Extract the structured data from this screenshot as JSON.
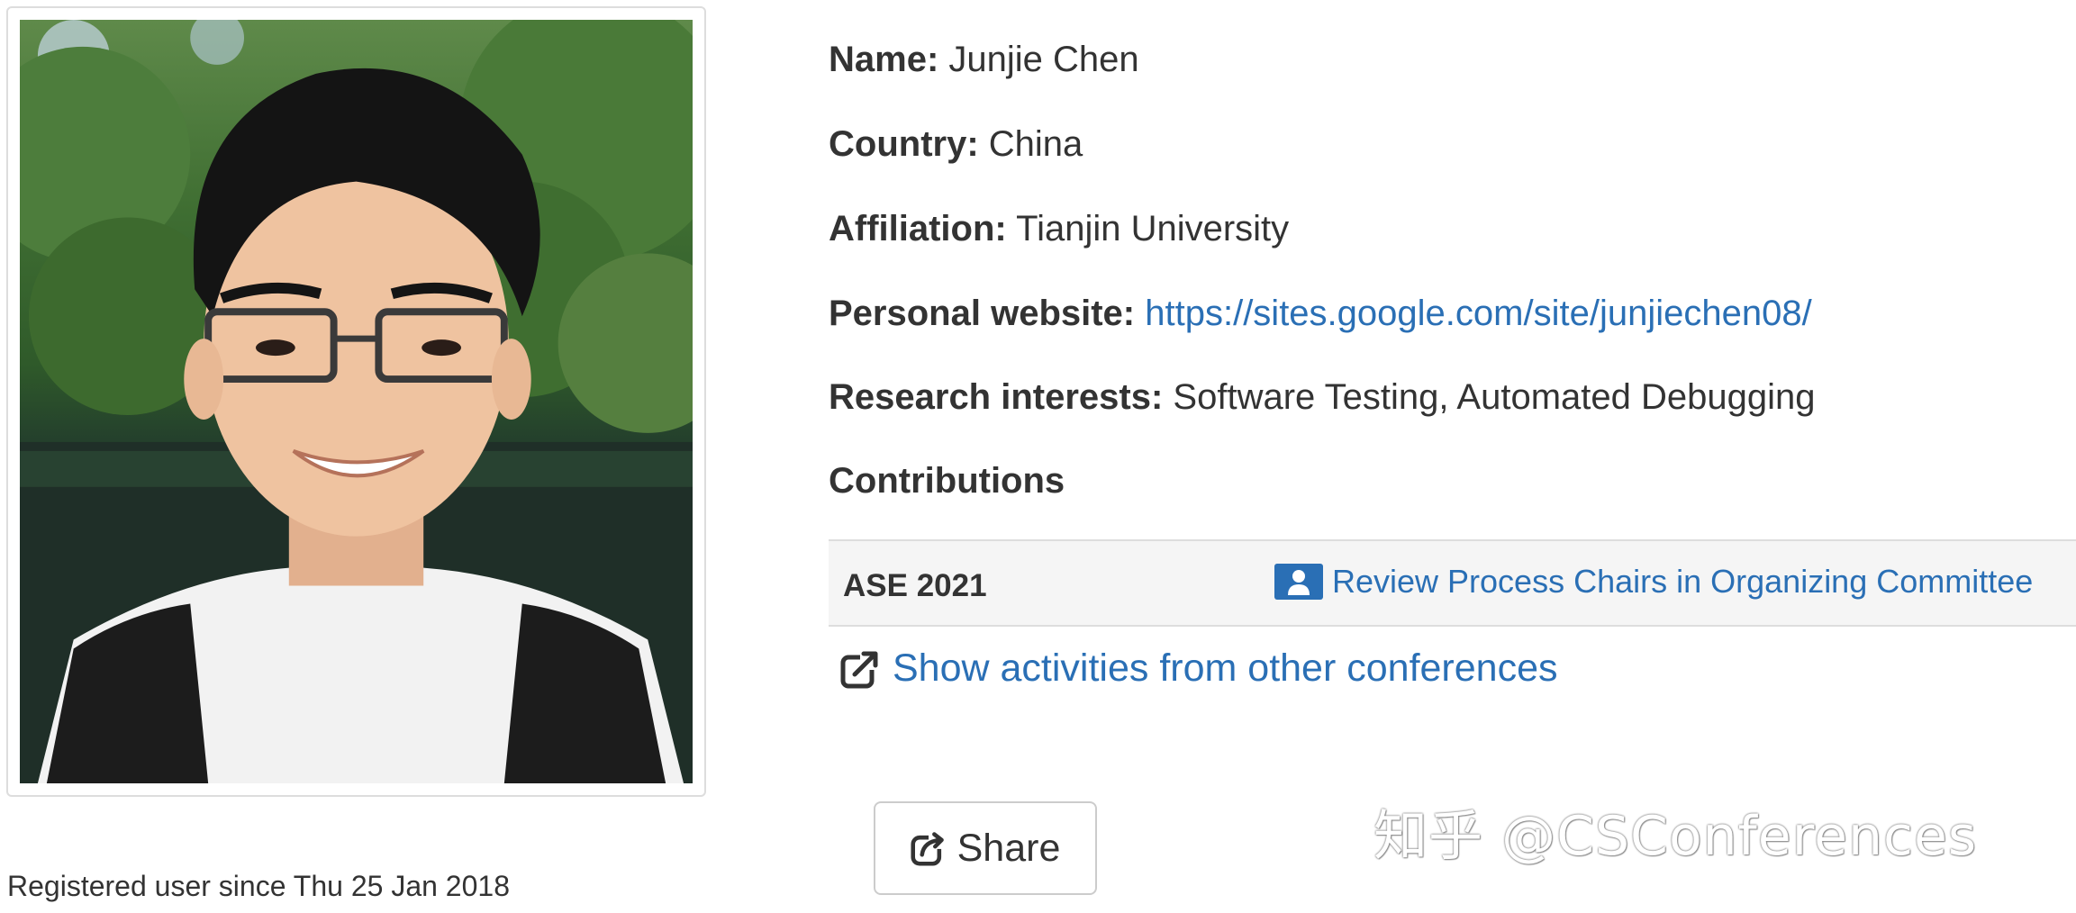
{
  "profile": {
    "photo_alt": "Junjie Chen",
    "registered_text": "Registered user since Thu 25 Jan 2018",
    "fields": {
      "name_label": "Name:",
      "name_value": "Junjie Chen",
      "country_label": "Country:",
      "country_value": "China",
      "affiliation_label": "Affiliation:",
      "affiliation_value": "Tianjin University",
      "website_label": "Personal website:",
      "website_value": "https://sites.google.com/site/junjiechen08/",
      "interests_label": "Research interests:",
      "interests_value": "Software Testing, Automated Debugging"
    }
  },
  "contributions": {
    "heading": "Contributions",
    "rows": [
      {
        "conference": "ASE 2021",
        "role_icon": "user-icon",
        "role": "Review Process Chairs in Organizing Committee"
      }
    ],
    "show_other_label": "Show activities from other conferences",
    "show_other_icon": "external-link-icon"
  },
  "share": {
    "label": "Share",
    "icon": "share-icon"
  },
  "watermark": {
    "text": "知乎 @CSConferences"
  },
  "colors": {
    "link": "#2a6fb5",
    "text": "#333333",
    "table_bg": "#f5f5f5",
    "border": "#dddddd"
  }
}
